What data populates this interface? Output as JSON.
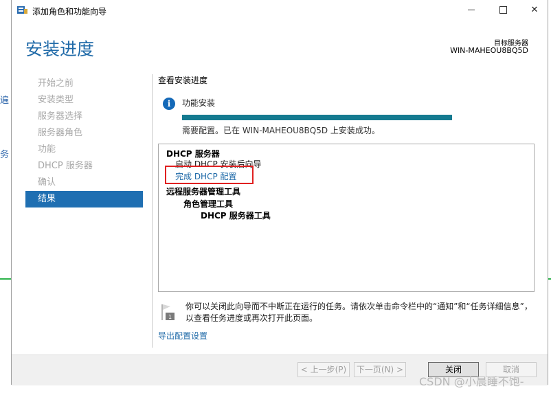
{
  "window": {
    "title": "添加角色和功能向导"
  },
  "header": {
    "title": "安装进度",
    "target_label": "目标服务器",
    "target_server": "WIN-MAHEOU8BQ5D"
  },
  "nav": {
    "items": [
      {
        "label": "开始之前",
        "active": false
      },
      {
        "label": "安装类型",
        "active": false
      },
      {
        "label": "服务器选择",
        "active": false
      },
      {
        "label": "服务器角色",
        "active": false
      },
      {
        "label": "功能",
        "active": false
      },
      {
        "label": "DHCP 服务器",
        "active": false
      },
      {
        "label": "确认",
        "active": false
      },
      {
        "label": "结果",
        "active": true
      }
    ]
  },
  "main": {
    "section_title": "查看安装进度",
    "feature_label": "功能安装",
    "progress": 1.0,
    "status": "需要配置。已在 WIN-MAHEOU8BQ5D 上安装成功。",
    "results": {
      "line1": "DHCP 服务器",
      "line2": "启动 DHCP 安装后向导",
      "line3_link": "完成 DHCP 配置",
      "line4": "远程服务器管理工具",
      "line5": "角色管理工具",
      "line6": "DHCP 服务器工具"
    },
    "note": "你可以关闭此向导而不中断正在运行的任务。请依次单击命令栏中的“通知”和“任务详细信息”，以查看任务进度或再次打开此页面。",
    "export_link": "导出配置设置"
  },
  "footer": {
    "prev": "< 上一步(P)",
    "next": "下一页(N) >",
    "close": "关闭",
    "cancel": "取消"
  },
  "watermark": "CSDN @小晨睡不饱-",
  "colors": {
    "accent": "#1f6fb2",
    "progress": "#147a90",
    "highlight": "#e02020"
  }
}
